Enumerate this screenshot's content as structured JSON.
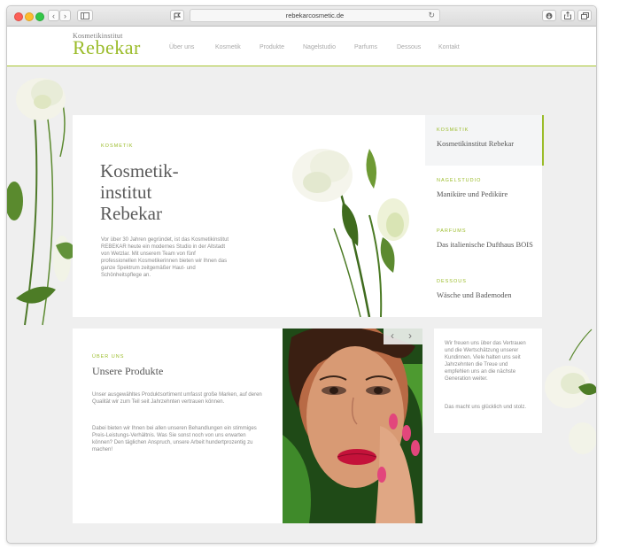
{
  "browser": {
    "url": "rebekarcosmetic.de"
  },
  "header": {
    "logo_top": "Kosmetikinstitut",
    "logo_main": "Rebekar",
    "nav": [
      "Über uns",
      "Kosmetik",
      "Produkte",
      "Nagelstudio",
      "Parfums",
      "Dessous",
      "Kontakt"
    ]
  },
  "hero": {
    "kicker": "KOSMETIK",
    "title_lines": [
      "Kosmetik-",
      "institut",
      "Rebekar"
    ],
    "body": "Vor über 30 Jahren gegründet, ist das Kosmetikinstitut REBEKAR heute ein modernes Studio in der Altstadt von Wetzlar. Mit unserem Team von fünf professionellen Kosmetikerinnen bieten wir Ihnen das ganze Spektrum zeitgemäßer Haut- und Schönheitspflege an."
  },
  "sidebar": [
    {
      "kicker": "KOSMETIK",
      "title": "Kosmetikinstitut Rebekar",
      "active": true
    },
    {
      "kicker": "NAGELSTUDIO",
      "title": "Maniküre und Pediküre",
      "active": false
    },
    {
      "kicker": "PARFUMS",
      "title": "Das italienische Dufthaus BOIS",
      "active": false
    },
    {
      "kicker": "DESSOUS",
      "title": "Wäsche und Bademoden",
      "active": false
    }
  ],
  "products": {
    "kicker": "ÜBER UNS",
    "title": "Unsere Produkte",
    "para1": "Unser ausgewähltes Produktsortiment umfasst große Marken, auf deren Qualität wir zum Teil seit Jahrzehnten vertrauen können.",
    "para2": "Dabei bieten wir Ihnen bei allen unseren Behandlungen ein stimmiges Preis-Leistungs-Verhältnis. Was Sie sonst noch von uns erwarten können? Den täglichen Anspruch, unsere Arbeit hundertprozentig zu machen!"
  },
  "quote": {
    "para1": "Wir freuen uns über das Vertrauen und die Wertschätzung unserer Kundinnen. Viele halten uns seit Jahrzehnten die Treue und empfehlen uns an die nächste Generation weiter.",
    "para2": "Das macht uns glücklich und stolz."
  },
  "colors": {
    "accent": "#9bbc2a",
    "text": "#555555",
    "muted": "#8a8a8a",
    "background": "#efefef"
  },
  "icons": {
    "back": "chevron-left-icon",
    "forward": "chevron-right-icon",
    "sidebar_toggle": "sidebar-icon",
    "share": "share-icon",
    "downloads": "download-icon",
    "tabs": "tabs-icon",
    "reload": "reload-icon"
  }
}
